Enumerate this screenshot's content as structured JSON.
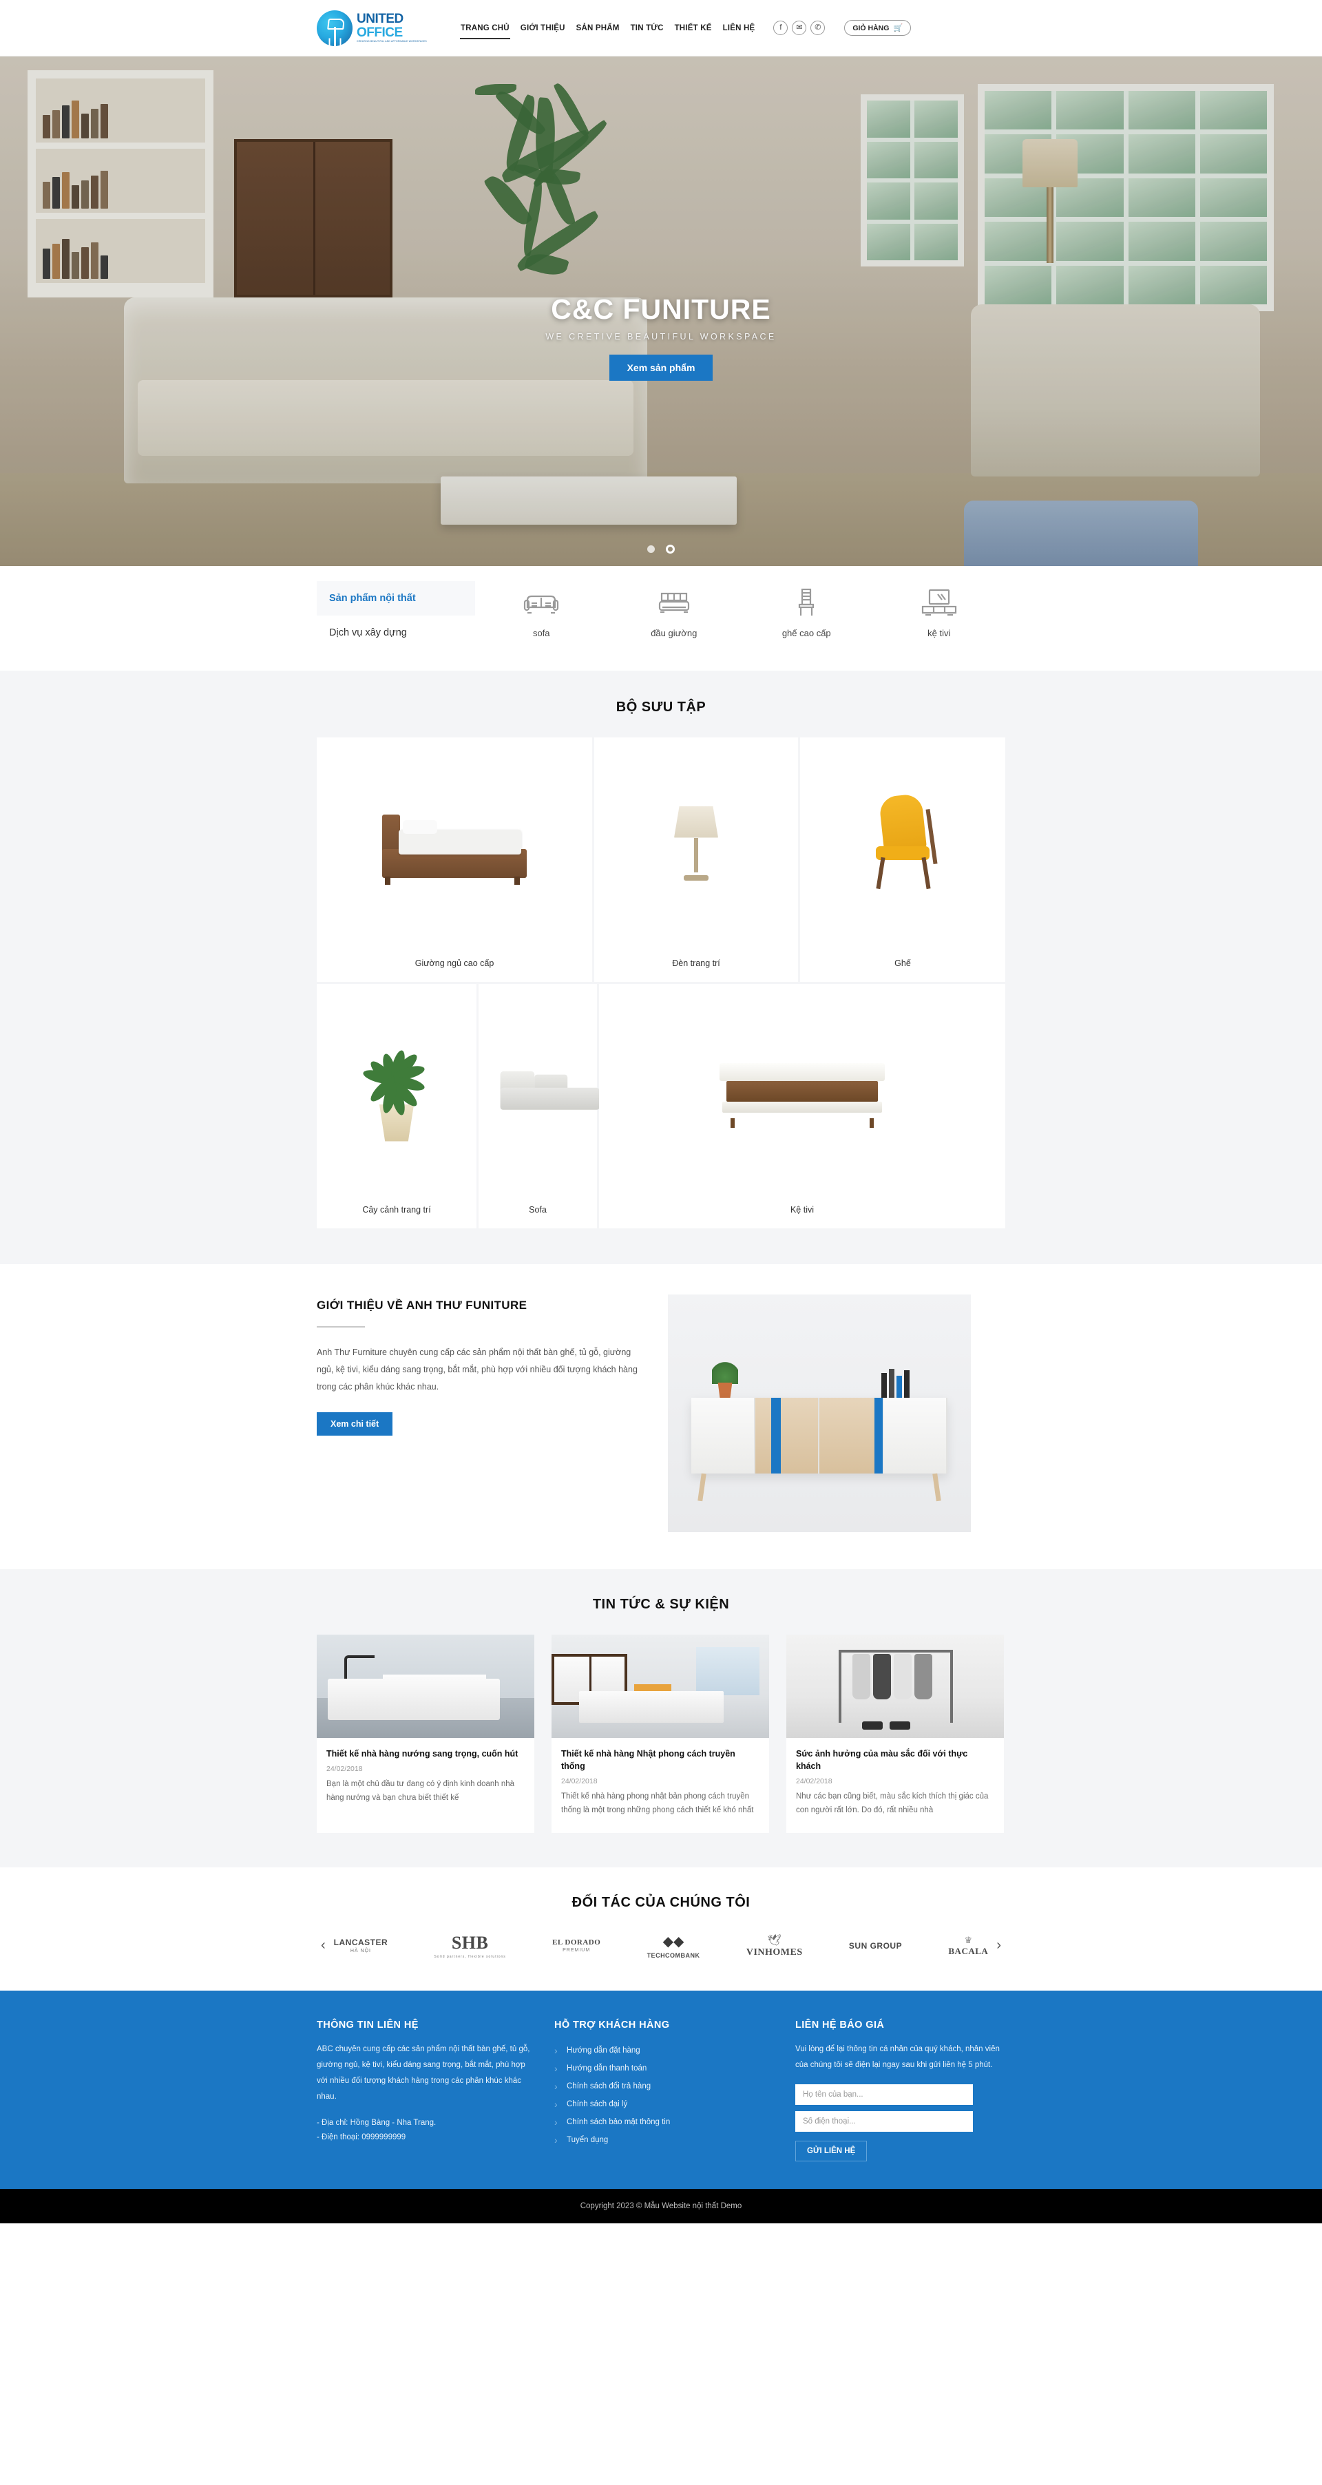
{
  "header": {
    "logo": {
      "word1": "UNITED",
      "word2": "OFFICE",
      "tagline": "CREATING BEAUTIFUL AND AFFORDABLE WORKSPACES"
    },
    "nav": [
      {
        "label": "TRANG CHỦ",
        "active": true
      },
      {
        "label": "GIỚI THIỆU",
        "active": false
      },
      {
        "label": "SẢN PHẨM",
        "active": false
      },
      {
        "label": "TIN TỨC",
        "active": false
      },
      {
        "label": "THIẾT KẾ",
        "active": false
      },
      {
        "label": "LIÊN HỆ",
        "active": false
      }
    ],
    "social": [
      {
        "name": "facebook-icon",
        "glyph": "f"
      },
      {
        "name": "mail-icon",
        "glyph": "✉"
      },
      {
        "name": "phone-icon",
        "glyph": "✆"
      }
    ],
    "cart": {
      "label": "GIỎ HÀNG",
      "icon": "🛒"
    }
  },
  "hero": {
    "title": "C&C FUNITURE",
    "subtitle": "WE CRETIVE BEAUTIFUL WORKSPACE",
    "button": "Xem sản phẩm",
    "dots": 2,
    "active_dot": 2
  },
  "categories": {
    "tab_active": "Sản phẩm nội thất",
    "tab_second": "Dịch vụ xây dựng",
    "items": [
      {
        "label": "sofa",
        "icon": "sofa-icon"
      },
      {
        "label": "đầu giường",
        "icon": "bed-icon"
      },
      {
        "label": "ghế cao cấp",
        "icon": "chair-icon"
      },
      {
        "label": "kệ tivi",
        "icon": "tv-stand-icon"
      }
    ]
  },
  "collection": {
    "title": "BỘ SƯU TẬP",
    "row1": [
      {
        "caption": "Giường ngủ cao cấp"
      },
      {
        "caption": "Đèn trang trí"
      },
      {
        "caption": "Ghế"
      }
    ],
    "row2": [
      {
        "caption": "Cây cảnh trang trí"
      },
      {
        "caption": "Sofa"
      },
      {
        "caption": "Kệ tivi"
      }
    ]
  },
  "about": {
    "title": "GIỚI THIỆU VỀ ANH THƯ FUNITURE",
    "text": "Anh Thư Furniture chuyên cung cấp các sản phẩm nội thất bàn ghế, tủ gỗ, giường ngủ, kệ tivi, kiểu dáng sang trọng, bắt mắt, phù hợp với nhiều đối tượng khách hàng trong các phân khúc khác nhau.",
    "button": "Xem chi tiết"
  },
  "news": {
    "title": "TIN TỨC & SỰ KIỆN",
    "items": [
      {
        "title": "Thiết kế nhà hàng nướng sang trọng, cuốn hút",
        "date": "24/02/2018",
        "excerpt": "Bạn là một chủ đầu tư đang có ý định kinh doanh nhà hàng nướng và bạn chưa biết thiết kế"
      },
      {
        "title": "Thiết kế nhà hàng Nhật phong cách truyền thống",
        "date": "24/02/2018",
        "excerpt": "Thiết kế nhà hàng phong nhật bản phong cách truyền thống là một trong những phong cách thiết kế khó nhất"
      },
      {
        "title": "Sức ảnh hưởng của màu sắc đối với thực khách",
        "date": "24/02/2018",
        "excerpt": "Như các bạn cũng biết, màu sắc kích thích thị giác của con người rất lớn. Do đó, rất nhiều nhà"
      }
    ]
  },
  "partners": {
    "title": "ĐỐI TÁC CỦA CHÚNG TÔI",
    "prev": "‹",
    "next": "›",
    "logos": [
      {
        "name": "LANCASTER",
        "sub": "HÀ NỘI",
        "size": 12
      },
      {
        "name": "SHB",
        "sub": "Solid partners, flexible solutions",
        "size": 26
      },
      {
        "name": "EL DORADO",
        "sub": "PREMIUM",
        "size": 11
      },
      {
        "name": "TECHCOMBANK",
        "sub": "",
        "size": 9
      },
      {
        "name": "VINHOMES",
        "sub": "",
        "size": 14
      },
      {
        "name": "SUN GROUP",
        "sub": "",
        "size": 12
      },
      {
        "name": "BACALA",
        "sub": "",
        "size": 13
      }
    ]
  },
  "footer": {
    "col1": {
      "title": "THÔNG TIN LIÊN HỆ",
      "text": "ABC chuyên cung cấp các sản phẩm nội thất bàn ghế, tủ gỗ, giường ngủ, kệ tivi, kiểu dáng sang trọng, bắt mắt, phù hợp với nhiều đối tượng khách hàng trong các phân khúc khác nhau.",
      "address": "- Địa chỉ: Hồng Bàng - Nha Trang.",
      "phone": "- Điện thoại: 0999999999"
    },
    "col2": {
      "title": "HỖ TRỢ KHÁCH HÀNG",
      "links": [
        "Hướng dẫn đặt hàng",
        "Hướng dẫn thanh toán",
        "Chính sách đổi trả hàng",
        "Chính sách đại lý",
        "Chính sách bảo mật thông tin",
        "Tuyển dụng"
      ]
    },
    "col3": {
      "title": "LIÊN HỆ BÁO GIÁ",
      "text": "Vui lòng để lại thông tin cá nhân của quý khách, nhân viên của chúng tôi sẽ điện lại ngay sau khi gửi liên hệ 5 phút.",
      "name_placeholder": "Họ tên của bạn...",
      "phone_placeholder": "Số điện thoại...",
      "submit": "GỬI LIÊN HỆ"
    }
  },
  "copyright": "Copyright 2023 © Mẫu Website nội thất Demo",
  "colors": {
    "brand": "#1b77c4",
    "accent": "#27a9e0",
    "dark": "#1464a5"
  }
}
